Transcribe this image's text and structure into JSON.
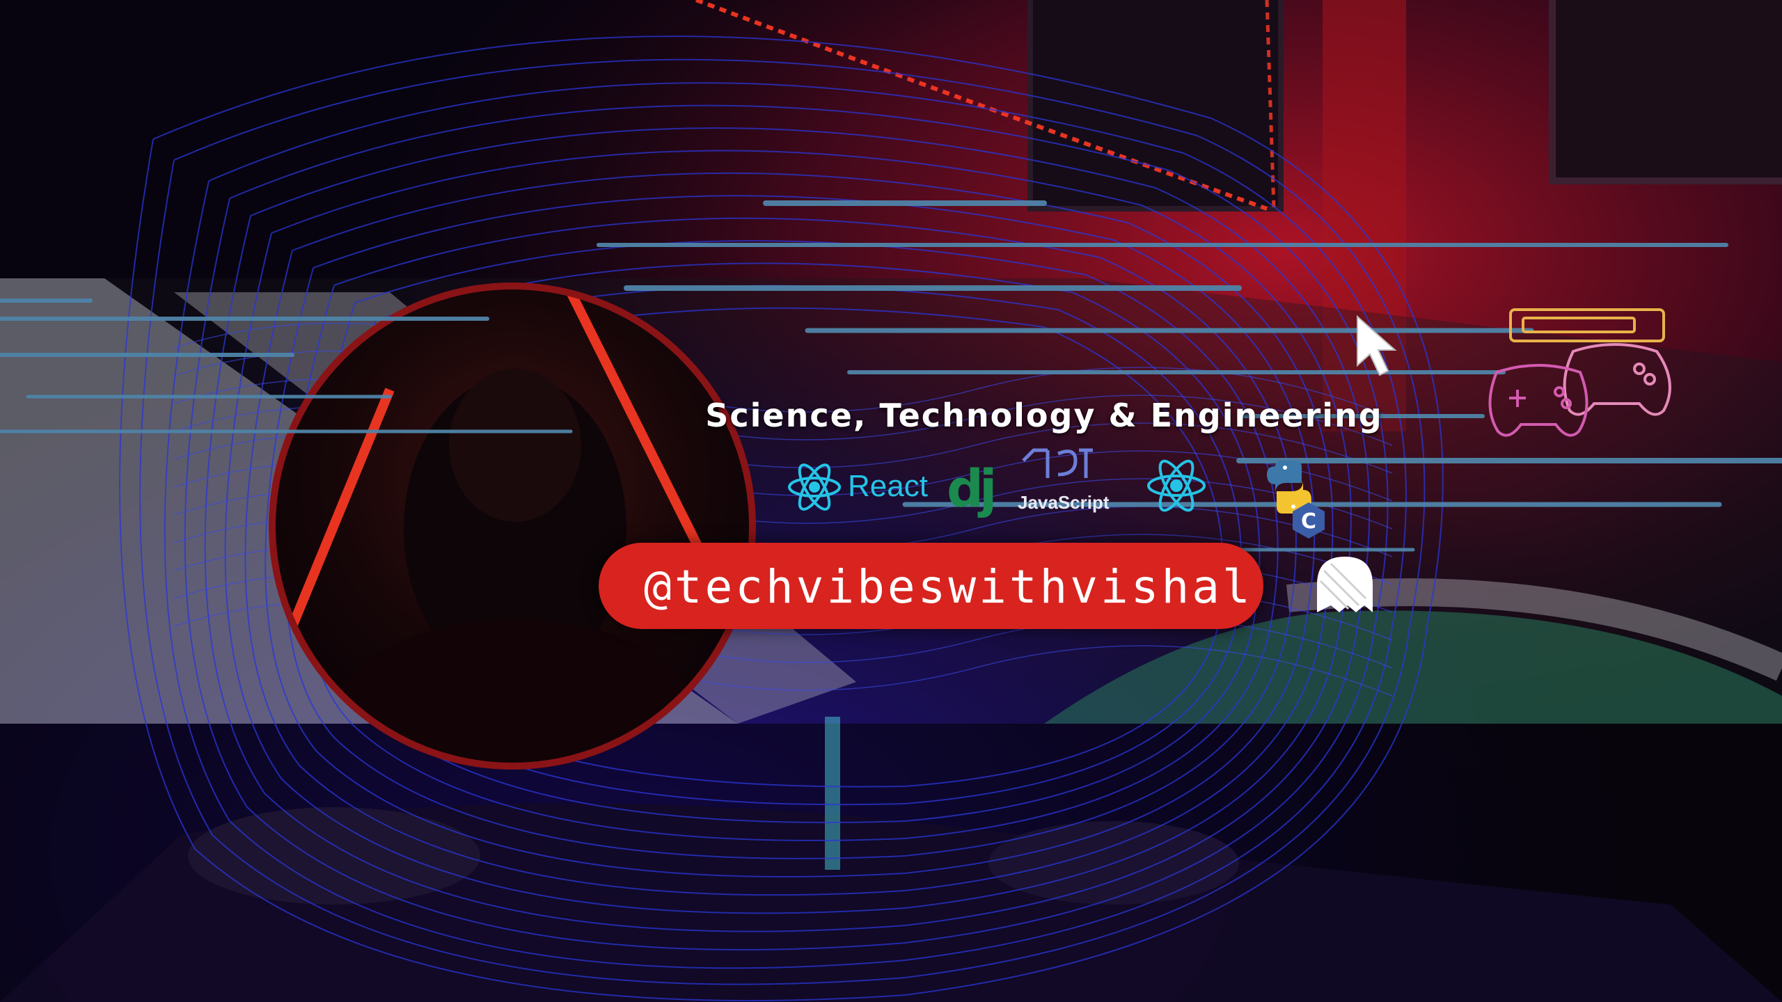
{
  "banner": {
    "tagline": "Science, Technology & Engineering",
    "handle": "@techvibeswithvishal"
  },
  "logos": {
    "react_label": "React",
    "django_label": "dj",
    "javascript_label": "JavaScript"
  },
  "icons": [
    "react-icon",
    "django-icon",
    "javascript-icon",
    "python-icon",
    "c-lang-icon",
    "cursor-arrow-icon",
    "game-controllers-icon",
    "ghost-icon"
  ],
  "colors": {
    "handle_pill": "#d8231f",
    "speed_lines": "#4f84a8",
    "wave_lines": "#2a36d6",
    "react": "#25c4e6",
    "controllers_gold": "#e8b34a",
    "controllers_pink": "#e35fb4",
    "neon_red": "#ff2b22"
  }
}
